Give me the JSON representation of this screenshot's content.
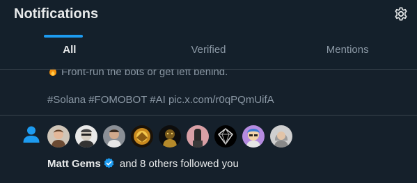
{
  "header": {
    "title": "Notifications",
    "settings_icon": "gear-icon"
  },
  "tabs": [
    {
      "label": "All",
      "active": true
    },
    {
      "label": "Verified",
      "active": false
    },
    {
      "label": "Mentions",
      "active": false
    }
  ],
  "tweet": {
    "line1": "Front-run the bots or get left behind.",
    "line1_icon": "fire-emoji",
    "line2": "#Solana  #FOMOBOT #AI pic.x.com/r0qPQmUifA"
  },
  "follow_notification": {
    "icon": "person-icon",
    "avatars": [
      "avatar-1",
      "avatar-2",
      "avatar-3",
      "avatar-4",
      "avatar-5",
      "avatar-6",
      "avatar-7",
      "avatar-8",
      "avatar-9"
    ],
    "user": "Matt Gems",
    "verified_icon": "verified-badge-icon",
    "text": " and 8 others followed you"
  },
  "colors": {
    "background": "#15202b",
    "accent": "#1d9bf0",
    "divider": "#38444d",
    "secondary_text": "#8b98a5",
    "primary_text": "#e7e9ea"
  }
}
